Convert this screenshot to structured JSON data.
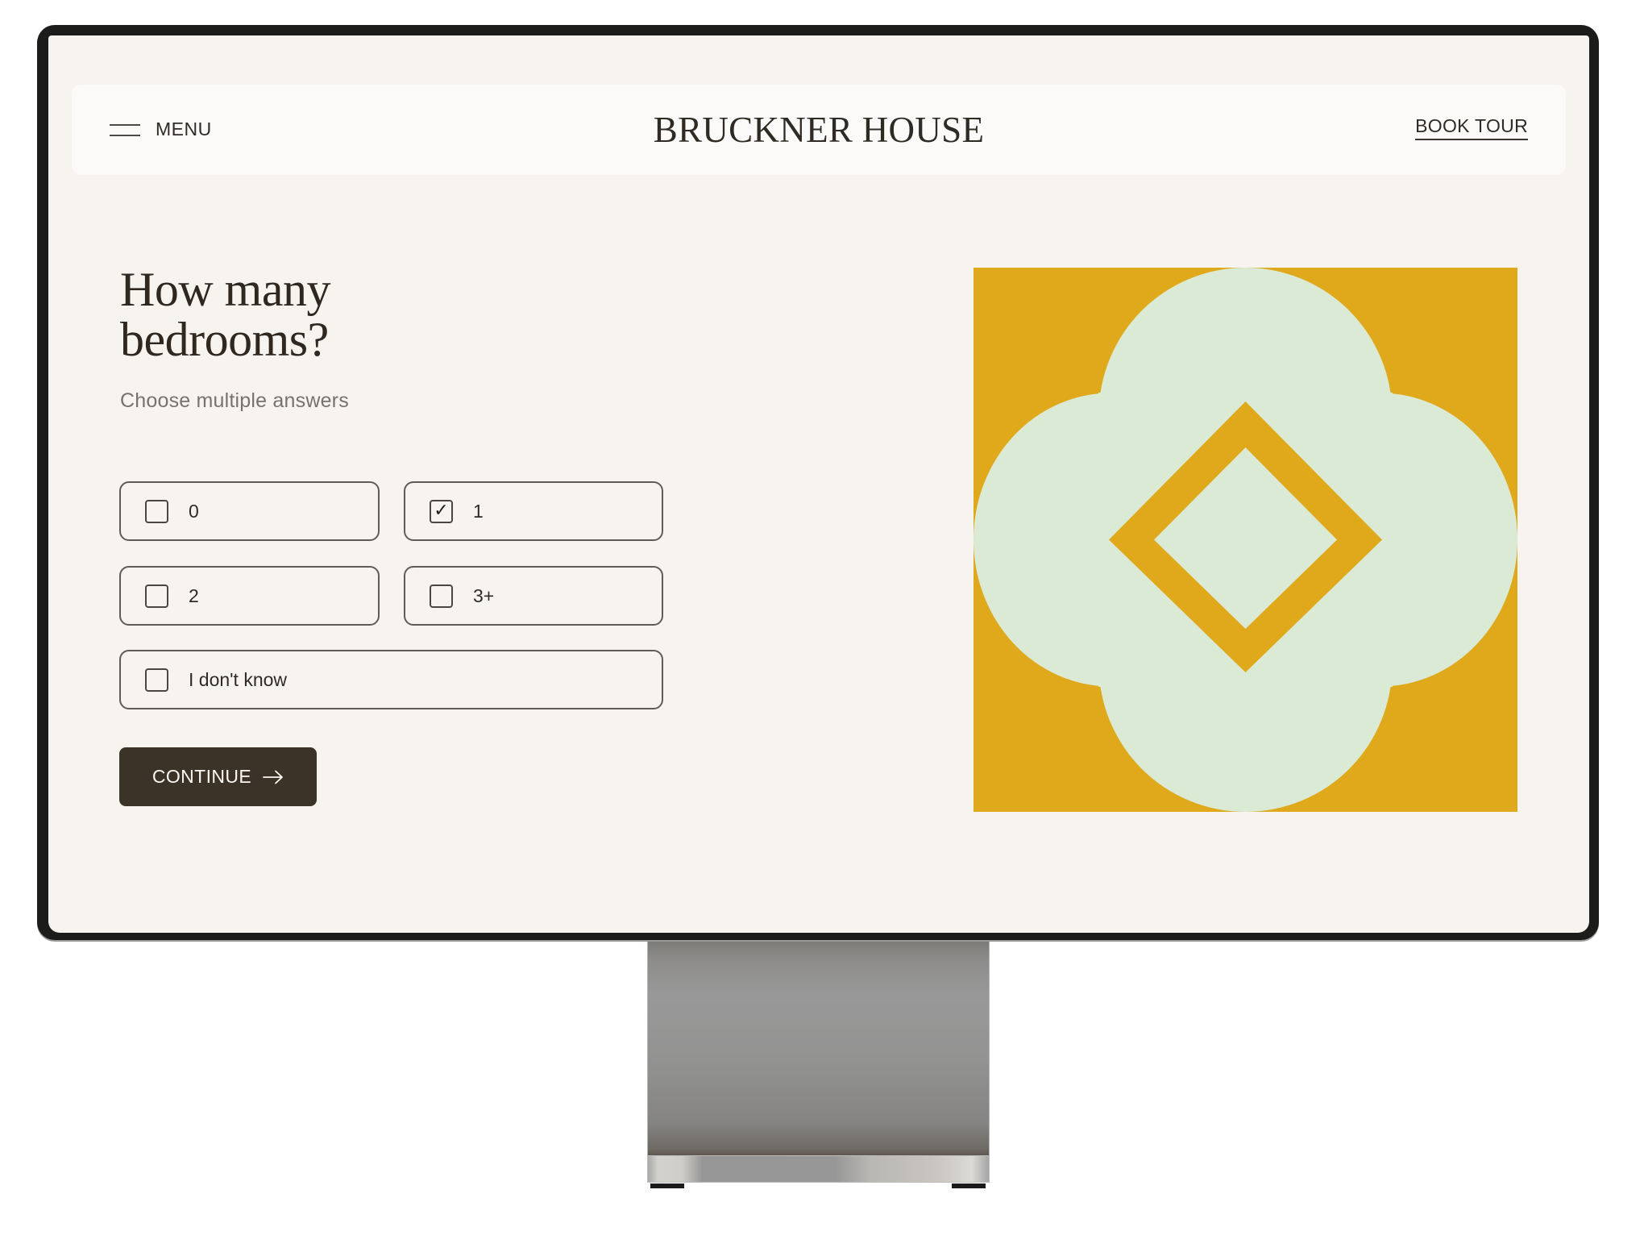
{
  "header": {
    "menu_label": "MENU",
    "logo": "BRUCKNER HOUSE",
    "book_tour_label": "BOOK TOUR"
  },
  "question": {
    "title_line1": "How many",
    "title_line2": "bedrooms?",
    "subtitle": "Choose multiple answers"
  },
  "options": [
    {
      "label": "0",
      "checked": false
    },
    {
      "label": "1",
      "checked": true
    },
    {
      "label": "2",
      "checked": false
    },
    {
      "label": "3+",
      "checked": false
    },
    {
      "label": "I don't know",
      "checked": false
    }
  ],
  "continue_label": "CONTINUE",
  "icons": {
    "menu": "hamburger-icon",
    "check": "✓",
    "arrow": "arrow-right-icon"
  },
  "colors": {
    "screen_bg": "#f7f3ee",
    "header_bg": "#fcfaf8",
    "text_dark": "#2e2820",
    "button_bg": "#3b3228",
    "illustration_gold": "#dfa91b",
    "illustration_mint": "#dbead5"
  }
}
